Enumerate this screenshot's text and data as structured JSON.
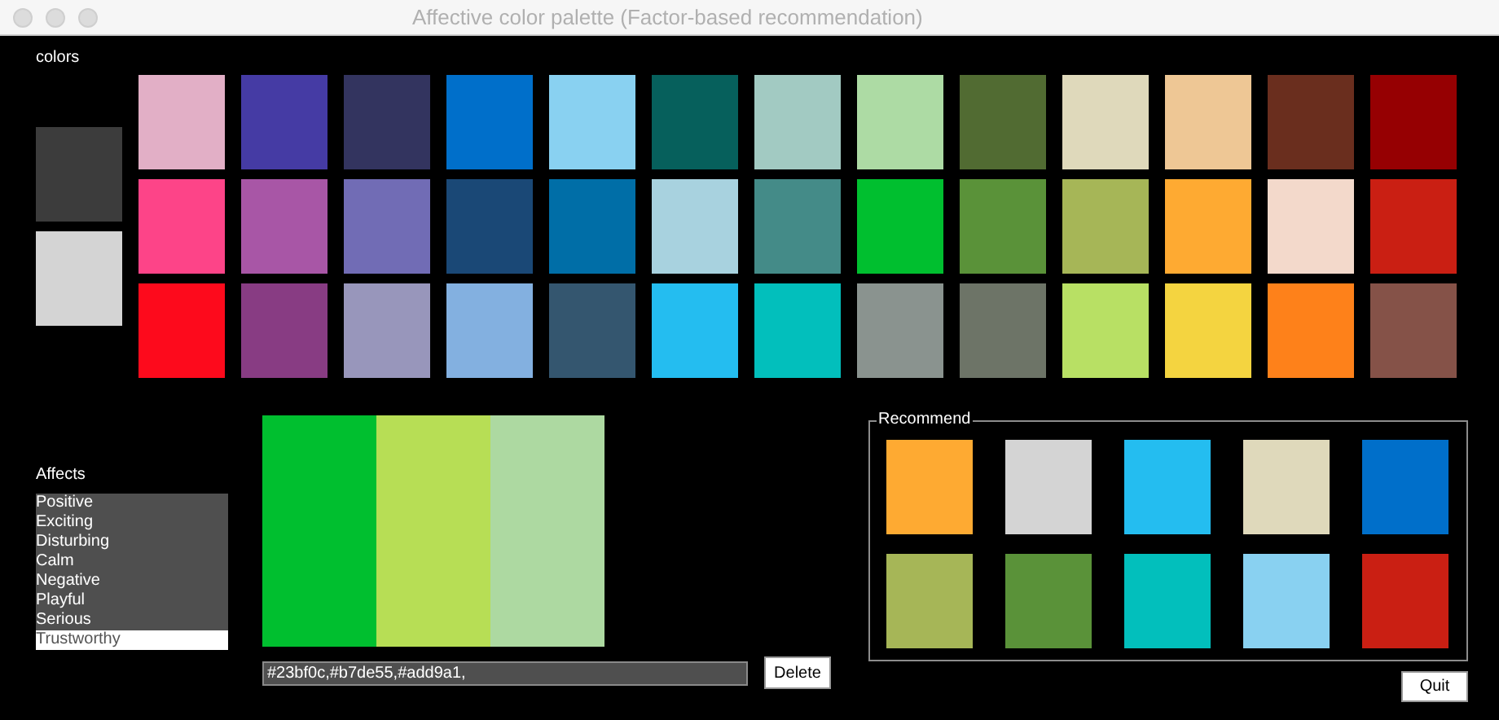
{
  "window": {
    "title": "Affective color palette (Factor-based recommendation)"
  },
  "colors": {
    "label": "colors",
    "current": [
      {
        "color": "#3c3c3c"
      },
      {
        "color": "#d4d4d4"
      }
    ],
    "swatches": [
      {
        "color": "#e2afc6"
      },
      {
        "color": "#453ba4"
      },
      {
        "color": "#33345f"
      },
      {
        "color": "#006fca"
      },
      {
        "color": "#89d1f1"
      },
      {
        "color": "#06605c"
      },
      {
        "color": "#a2cac2"
      },
      {
        "color": "#addba4"
      },
      {
        "color": "#516b32"
      },
      {
        "color": "#dfd9bb"
      },
      {
        "color": "#eec795"
      },
      {
        "color": "#6a2e1e"
      },
      {
        "color": "#960002"
      },
      {
        "color": "#fd4488"
      },
      {
        "color": "#a856a6"
      },
      {
        "color": "#716cb5"
      },
      {
        "color": "#1a4876"
      },
      {
        "color": "#006ea7"
      },
      {
        "color": "#a8d2df"
      },
      {
        "color": "#448b88"
      },
      {
        "color": "#00bf2f"
      },
      {
        "color": "#5a9239"
      },
      {
        "color": "#a6b657"
      },
      {
        "color": "#feaa32"
      },
      {
        "color": "#f3d9cb"
      },
      {
        "color": "#ca1f13"
      },
      {
        "color": "#fd0a1c"
      },
      {
        "color": "#883c83"
      },
      {
        "color": "#9896bb"
      },
      {
        "color": "#83b0e0"
      },
      {
        "color": "#34566f"
      },
      {
        "color": "#24bdf0"
      },
      {
        "color": "#02bfbc"
      },
      {
        "color": "#8a938f"
      },
      {
        "color": "#6d7467"
      },
      {
        "color": "#b8e064"
      },
      {
        "color": "#f4d440"
      },
      {
        "color": "#fe811a"
      },
      {
        "color": "#855248"
      }
    ]
  },
  "affects": {
    "label": "Affects",
    "items": [
      {
        "label": "Positive",
        "selected": false
      },
      {
        "label": "Exciting",
        "selected": false
      },
      {
        "label": "Disturbing",
        "selected": false
      },
      {
        "label": "Calm",
        "selected": false
      },
      {
        "label": "Negative",
        "selected": false
      },
      {
        "label": "Playful",
        "selected": false
      },
      {
        "label": "Serious",
        "selected": false
      },
      {
        "label": "Trustworthy",
        "selected": true
      }
    ]
  },
  "palette": {
    "swatches": [
      {
        "color": "#00bf2f"
      },
      {
        "color": "#b7de55"
      },
      {
        "color": "#add9a1"
      }
    ],
    "value": "#23bf0c,#b7de55,#add9a1,",
    "delete_button": "Delete"
  },
  "recommend": {
    "label": "Recommend",
    "swatches": [
      {
        "color": "#feaa32"
      },
      {
        "color": "#d4d4d4"
      },
      {
        "color": "#24bdf0"
      },
      {
        "color": "#dfd9bb"
      },
      {
        "color": "#006fca"
      },
      {
        "color": "#a6b657"
      },
      {
        "color": "#5a9239"
      },
      {
        "color": "#02bfbc"
      },
      {
        "color": "#89d1f1"
      },
      {
        "color": "#ca1f13"
      }
    ]
  },
  "quit_button": "Quit"
}
